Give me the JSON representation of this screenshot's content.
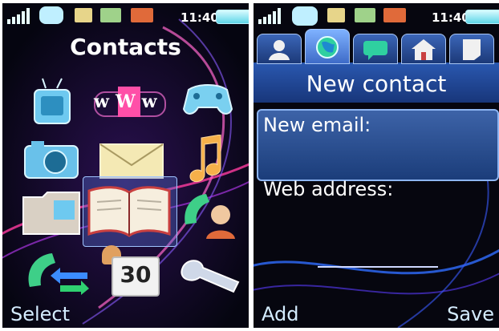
{
  "status_bar": {
    "time": "11:40",
    "icons": [
      "signal-icon",
      "bluetooth-icon",
      "card-icon",
      "message-icon",
      "rss-icon",
      "battery-icon"
    ]
  },
  "left_screen": {
    "title": "Contacts",
    "softkey_left": "Select",
    "menu_icons": [
      "tv-icon",
      "www-icon",
      "gamepad-icon",
      "camera-icon",
      "envelope-icon",
      "music-note-icon",
      "folder-icon",
      "book-icon",
      "phone-contact-icon",
      "call-log-icon",
      "alarm-calendar-icon",
      "settings-wrench-icon"
    ],
    "www_text": "wWw",
    "calendar_text": "30"
  },
  "right_screen": {
    "title": "New contact",
    "fields": [
      {
        "label": "New email:",
        "value": ""
      },
      {
        "label": "Web address:",
        "value": ""
      }
    ],
    "tabs": [
      "person-tab-icon",
      "globe-tab-icon",
      "chat-tab-icon",
      "home-tab-icon",
      "note-tab-icon"
    ],
    "softkey_left": "Add",
    "softkey_right": "Save"
  },
  "colors": {
    "accent": "#2a58b0",
    "swirl_pink": "#ff3ca0",
    "swirl_blue": "#3d7bff"
  }
}
